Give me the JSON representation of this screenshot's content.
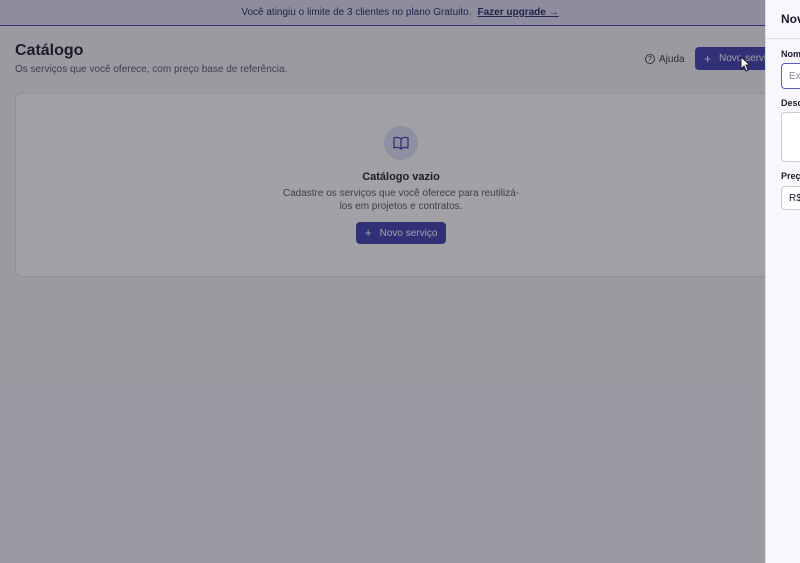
{
  "banner": {
    "text": "Você atingiu o limite de 3 clientes no plano Gratuito.",
    "link": "Fazer upgrade →"
  },
  "header": {
    "title": "Catálogo",
    "subtitle": "Os serviços que você oferece, com preço base de referência.",
    "help_label": "Ajuda",
    "new_button_label": "Novo serviço"
  },
  "empty_state": {
    "icon": "book-open-icon",
    "title": "Catálogo vazio",
    "description": "Cadastre os serviços que você oferece para reutilizá-los em projetos e contratos.",
    "button_label": "Novo serviço"
  },
  "drawer": {
    "title": "Novo serviço",
    "fields": {
      "name_label": "Nome",
      "name_placeholder": "Ex",
      "description_label": "Descrição",
      "price_label": "Preço",
      "price_prefix": "R$"
    }
  },
  "colors": {
    "accent": "#3f3faf",
    "banner_bg": "#dcdcf2",
    "overlay": "rgba(32,32,44,0.42)"
  }
}
